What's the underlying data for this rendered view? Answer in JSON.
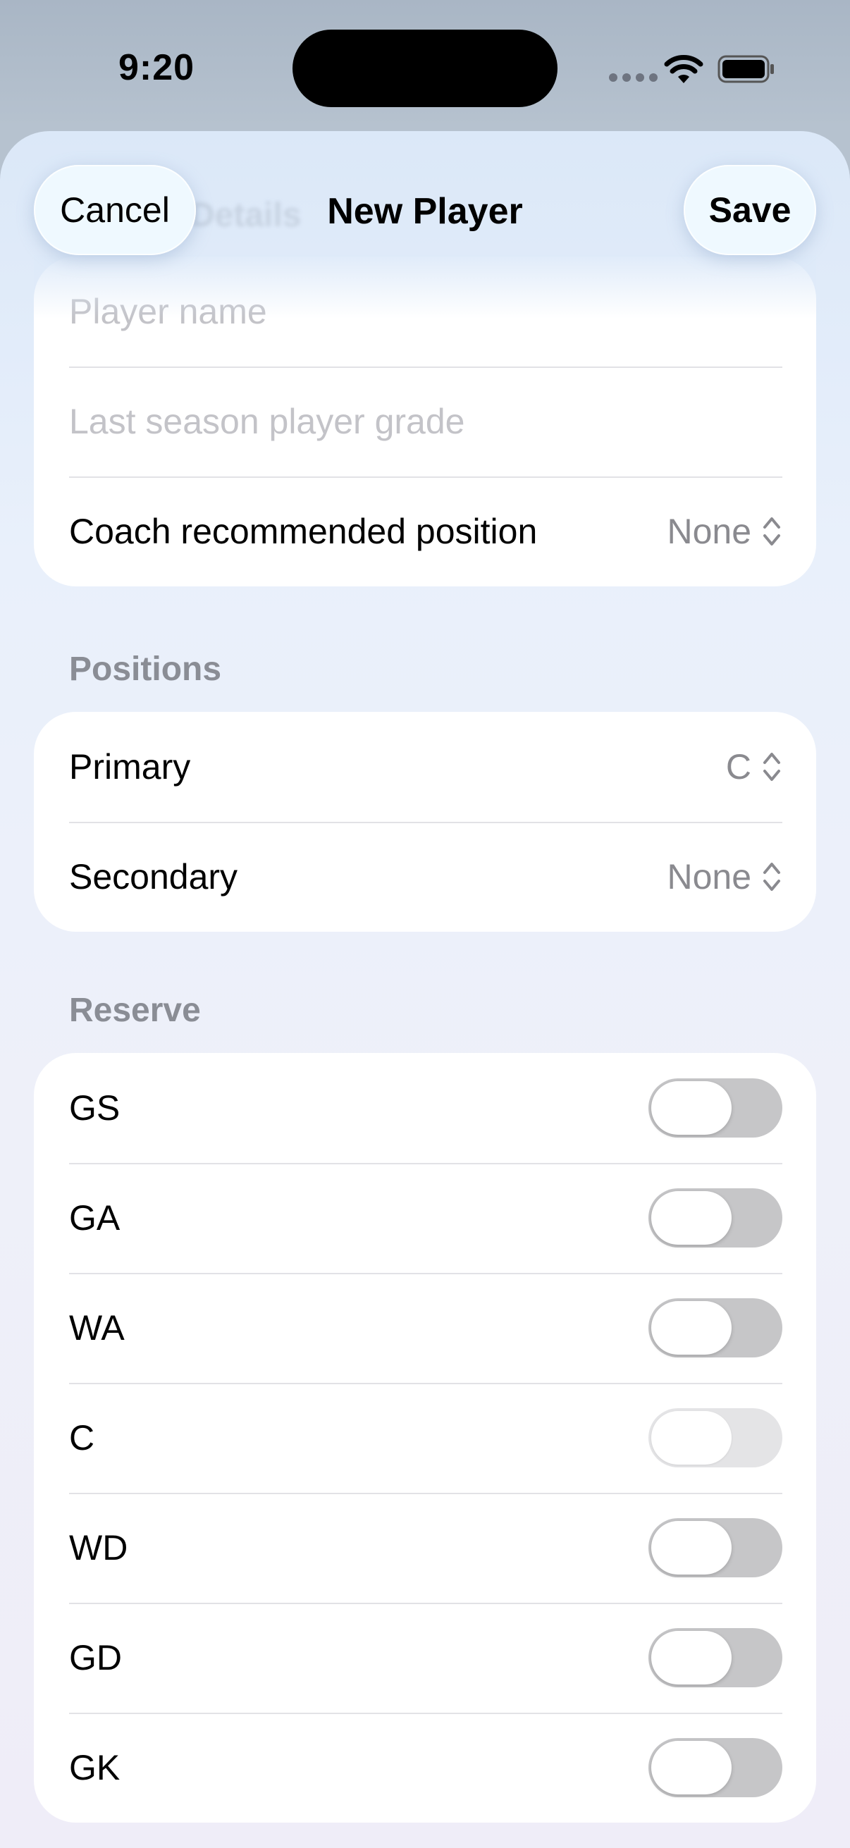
{
  "status_bar": {
    "time": "9:20"
  },
  "nav": {
    "cancel_label": "Cancel",
    "title": "New Player",
    "save_label": "Save",
    "ghost_title": "Details"
  },
  "details": {
    "name_placeholder": "Player name",
    "grade_placeholder": "Last season player grade",
    "coach_label": "Coach recommended position",
    "coach_value": "None"
  },
  "positions": {
    "header": "Positions",
    "primary_label": "Primary",
    "primary_value": "C",
    "secondary_label": "Secondary",
    "secondary_value": "None"
  },
  "reserve": {
    "header": "Reserve",
    "items": [
      {
        "label": "GS",
        "on": false,
        "enabled": true
      },
      {
        "label": "GA",
        "on": false,
        "enabled": true
      },
      {
        "label": "WA",
        "on": false,
        "enabled": true
      },
      {
        "label": "C",
        "on": false,
        "enabled": false
      },
      {
        "label": "WD",
        "on": false,
        "enabled": true
      },
      {
        "label": "GD",
        "on": false,
        "enabled": true
      },
      {
        "label": "GK",
        "on": false,
        "enabled": true
      }
    ]
  }
}
